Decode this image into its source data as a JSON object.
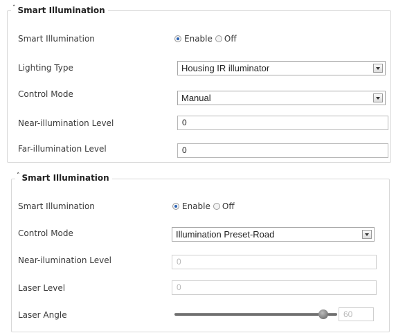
{
  "panel1": {
    "legend": "Smart Illumination",
    "smart_illumination_label": "Smart Illumination",
    "enable_label": "Enable",
    "off_label": "Off",
    "lighting_type_label": "Lighting Type",
    "lighting_type_value": "Housing IR illuminator",
    "control_mode_label": "Control Mode",
    "control_mode_value": "Manual",
    "near_label": "Near-illumination Level",
    "near_value": "0",
    "far_label": "Far-illumination Level",
    "far_value": "0"
  },
  "panel2": {
    "legend": "Smart Illumination",
    "smart_illumination_label": "Smart Illumination",
    "enable_label": "Enable",
    "off_label": "Off",
    "control_mode_label": "Control Mode",
    "control_mode_value": "Illumination Preset-Road",
    "near_label": "Near-ilumination Level",
    "near_value": "0",
    "laser_level_label": "Laser Level",
    "laser_level_value": "0",
    "laser_angle_label": "Laser Angle",
    "laser_angle_value": "60"
  }
}
